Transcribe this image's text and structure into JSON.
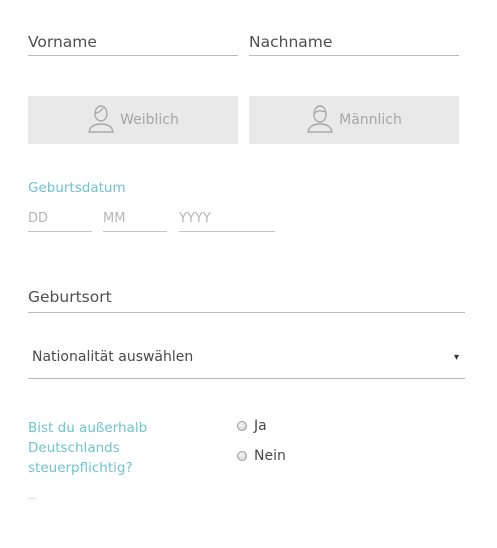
{
  "name": {
    "first_label": "Vorname",
    "last_label": "Nachname"
  },
  "gender": {
    "female_label": "Weiblich",
    "male_label": "Männlich",
    "female_icon": "person-female-icon",
    "male_icon": "person-male-icon"
  },
  "birth_date": {
    "caption": "Geburtsdatum",
    "day_placeholder": "DD",
    "month_placeholder": "MM",
    "year_placeholder": "YYYY"
  },
  "birth_place": {
    "label": "Geburtsort"
  },
  "nationality": {
    "label": "Nationalität auswählen",
    "arrow": "▾"
  },
  "tax": {
    "question": "Bist du außerhalb Deutschlands steuerpflichtig?",
    "options": [
      "Ja",
      "Nein"
    ]
  },
  "colors": {
    "accent": "#6fc4cf",
    "button_bg": "#e9e9e9",
    "text": "#4a4a4a",
    "placeholder": "#b5b5b5"
  }
}
